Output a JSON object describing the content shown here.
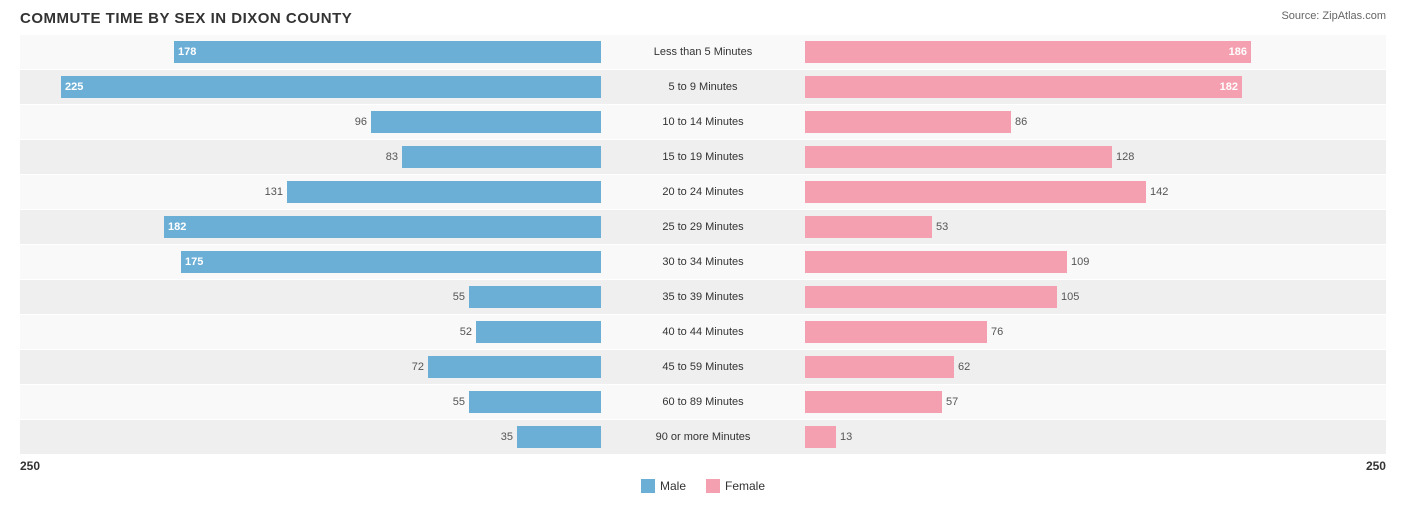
{
  "title": "COMMUTE TIME BY SEX IN DIXON COUNTY",
  "source": "Source: ZipAtlas.com",
  "max_value": 250,
  "legend": {
    "male_label": "Male",
    "female_label": "Female",
    "male_color": "#6baed6",
    "female_color": "#f4a0b0"
  },
  "axis": {
    "left": "250",
    "right": "250"
  },
  "rows": [
    {
      "label": "Less than 5 Minutes",
      "male": 178,
      "female": 186,
      "male_inside": true,
      "female_inside": true
    },
    {
      "label": "5 to 9 Minutes",
      "male": 225,
      "female": 182,
      "male_inside": true,
      "female_inside": true
    },
    {
      "label": "10 to 14 Minutes",
      "male": 96,
      "female": 86,
      "male_inside": false,
      "female_inside": false
    },
    {
      "label": "15 to 19 Minutes",
      "male": 83,
      "female": 128,
      "male_inside": false,
      "female_inside": false
    },
    {
      "label": "20 to 24 Minutes",
      "male": 131,
      "female": 142,
      "male_inside": false,
      "female_inside": false
    },
    {
      "label": "25 to 29 Minutes",
      "male": 182,
      "female": 53,
      "male_inside": true,
      "female_inside": false
    },
    {
      "label": "30 to 34 Minutes",
      "male": 175,
      "female": 109,
      "male_inside": true,
      "female_inside": false
    },
    {
      "label": "35 to 39 Minutes",
      "male": 55,
      "female": 105,
      "male_inside": false,
      "female_inside": false
    },
    {
      "label": "40 to 44 Minutes",
      "male": 52,
      "female": 76,
      "male_inside": false,
      "female_inside": false
    },
    {
      "label": "45 to 59 Minutes",
      "male": 72,
      "female": 62,
      "male_inside": false,
      "female_inside": false
    },
    {
      "label": "60 to 89 Minutes",
      "male": 55,
      "female": 57,
      "male_inside": false,
      "female_inside": false
    },
    {
      "label": "90 or more Minutes",
      "male": 35,
      "female": 13,
      "male_inside": false,
      "female_inside": false
    }
  ]
}
